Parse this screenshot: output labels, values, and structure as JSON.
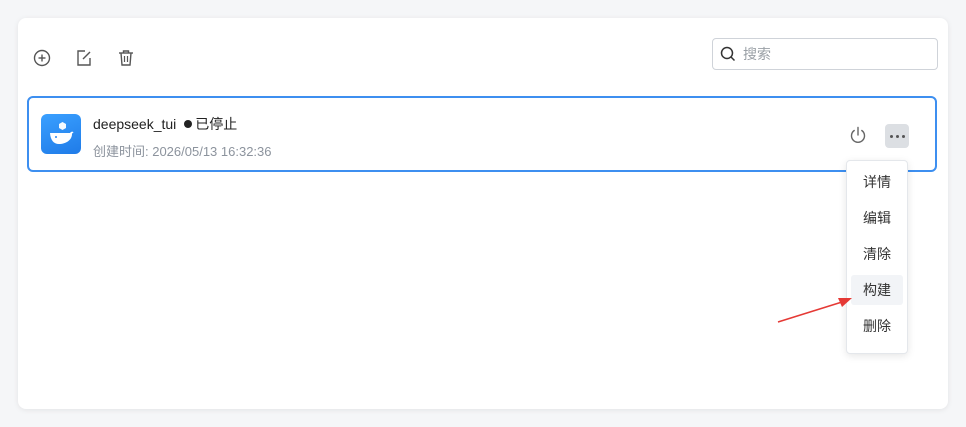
{
  "toolbar": {
    "add_icon": "plus-circle-icon",
    "edit_icon": "edit-icon",
    "delete_icon": "trash-icon"
  },
  "search": {
    "placeholder": "搜索",
    "value": ""
  },
  "card": {
    "name": "deepseek_tui",
    "status": "已停止",
    "created_label": "创建时间: 2026/05/13 16:32:36",
    "icon": "docker-icon"
  },
  "menu": {
    "items": [
      {
        "label": "详情"
      },
      {
        "label": "编辑"
      },
      {
        "label": "清除"
      },
      {
        "label": "构建"
      },
      {
        "label": "删除"
      }
    ]
  },
  "colors": {
    "accent": "#3d8ff0",
    "arrow": "#e53935"
  }
}
